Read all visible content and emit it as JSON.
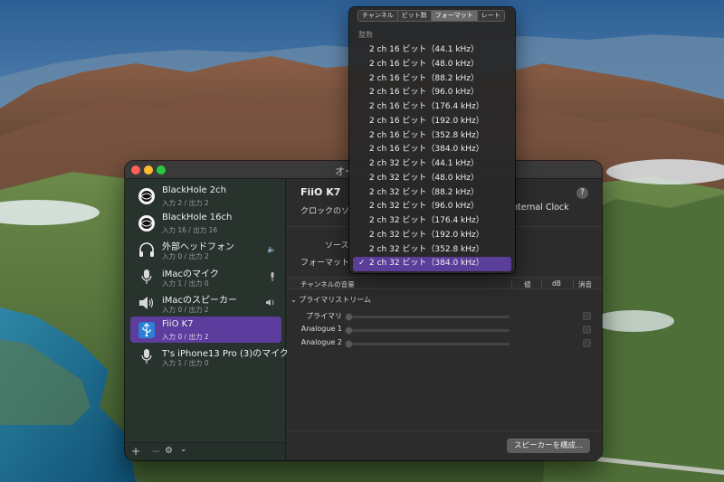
{
  "window": {
    "title": "オー"
  },
  "sidebar": {
    "devices": [
      {
        "name": "BlackHole 2ch",
        "io": "入力 2 / 出力 2",
        "icon": "blackhole-icon"
      },
      {
        "name": "BlackHole 16ch",
        "io": "入力 16 / 出力 16",
        "icon": "blackhole-icon"
      },
      {
        "name": "外部ヘッドフォン",
        "io": "入力 0 / 出力 2",
        "icon": "headphones-icon",
        "right_icon": "speaker-volume-icon"
      },
      {
        "name": "iMacのマイク",
        "io": "入力 1 / 出力 0",
        "icon": "microphone-icon",
        "right_icon": "microphone-small-icon"
      },
      {
        "name": "iMacのスピーカー",
        "io": "入力 0 / 出力 2",
        "icon": "speaker-icon",
        "right_icon": "sound-output-icon"
      },
      {
        "name": "FiiO K7",
        "io": "入力 0 / 出力 2",
        "icon": "usb-icon",
        "selected": true
      },
      {
        "name": "T's iPhone13 Pro (3)のマイク",
        "io": "入力 1 / 出力 0",
        "icon": "microphone-icon"
      }
    ],
    "bottom": {
      "add": "+",
      "remove": "−",
      "gear": "⚙",
      "chevron": "⌄"
    }
  },
  "main": {
    "device_title": "FiiO K7",
    "clock_label": "クロックのソー",
    "clock_value": "nternal Clock",
    "help": "?",
    "source_label": "ソース",
    "format_label": "フォーマット",
    "table": {
      "headers": {
        "volume": "チャンネルの音量",
        "value": "値",
        "db": "dB",
        "mute": "消音"
      }
    },
    "stream_group": "プライマリストリーム",
    "channels": [
      {
        "label": "プライマリ"
      },
      {
        "label": "Analogue 1"
      },
      {
        "label": "Analogue 2"
      }
    ],
    "configure_button": "スピーカーを構成..."
  },
  "menu": {
    "tabs": [
      {
        "label": "チャンネル",
        "active": false
      },
      {
        "label": "ビット数",
        "active": false
      },
      {
        "label": "フォーマット",
        "active": true
      },
      {
        "label": "レート",
        "active": false
      }
    ],
    "header": "整数",
    "items": [
      {
        "label": "2 ch 16 ビット（44.1 kHz）"
      },
      {
        "label": "2 ch 16 ビット（48.0 kHz）"
      },
      {
        "label": "2 ch 16 ビット（88.2 kHz）"
      },
      {
        "label": "2 ch 16 ビット（96.0 kHz）"
      },
      {
        "label": "2 ch 16 ビット（176.4 kHz）"
      },
      {
        "label": "2 ch 16 ビット（192.0 kHz）"
      },
      {
        "label": "2 ch 16 ビット（352.8 kHz）"
      },
      {
        "label": "2 ch 16 ビット（384.0 kHz）"
      },
      {
        "label": "2 ch 32 ビット（44.1 kHz）"
      },
      {
        "label": "2 ch 32 ビット（48.0 kHz）"
      },
      {
        "label": "2 ch 32 ビット（88.2 kHz）"
      },
      {
        "label": "2 ch 32 ビット（96.0 kHz）"
      },
      {
        "label": "2 ch 32 ビット（176.4 kHz）"
      },
      {
        "label": "2 ch 32 ビット（192.0 kHz）"
      },
      {
        "label": "2 ch 32 ビット（352.8 kHz）"
      },
      {
        "label": "2 ch 32 ビット（384.0 kHz）",
        "selected": true,
        "check": "✓"
      }
    ]
  },
  "colors": {
    "selection": "#5c3c9c",
    "menu_selection": "#5b3d9a"
  }
}
